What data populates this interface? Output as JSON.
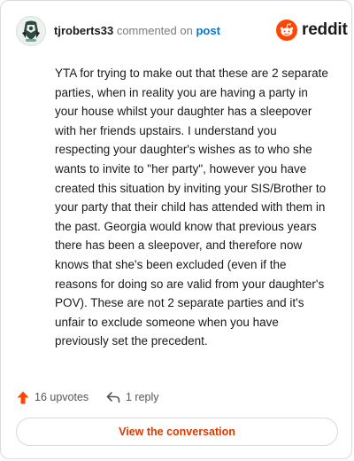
{
  "header": {
    "username": "tjroberts33",
    "action_text": "commented on",
    "post_link": "post"
  },
  "brand": {
    "logo_icon": "reddit-snoo-icon",
    "name": "reddit",
    "color": "#ff4500"
  },
  "comment": {
    "text": "YTA for trying to make out that these are 2 separate parties, when in reality you are having a party in your house whilst your daughter has a sleepover with her friends upstairs. I understand you respecting your daughter's wishes as to who she wants to invite to \"her party\", however you have created this situation by inviting your SIS/Brother to your party that their child has attended with them in the past. Georgia would know that previous years there has been a sleepover, and therefore now knows that she's been excluded (even if the reasons for doing so are valid from your daughter's POV). These are not 2 separate parties and it's unfair to exclude someone when you have previously set the precedent."
  },
  "footer": {
    "upvote_icon": "upvote-arrow-icon",
    "upvotes_label": "16 upvotes",
    "reply_icon": "reply-icon",
    "replies_label": "1 reply",
    "view_button_label": "View the conversation"
  },
  "colors": {
    "accent": "#d93a00",
    "link": "#0079d3",
    "upvote": "#ff4500"
  }
}
